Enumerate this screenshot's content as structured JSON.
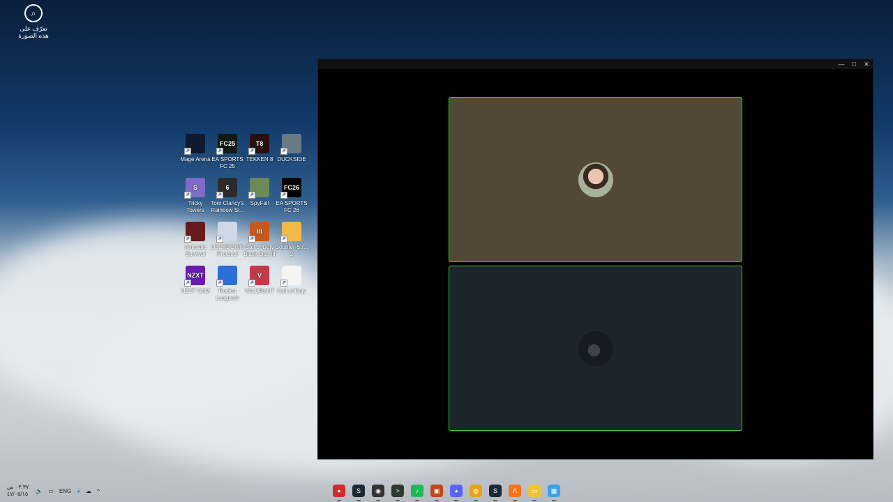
{
  "desktop": {
    "top_shortcut": {
      "line1": "تعرّف على",
      "line2": "هذه الصورة"
    },
    "icons": [
      {
        "label": "Mage Arena",
        "color": "#101a2e",
        "glyph": ""
      },
      {
        "label": "EA SPORTS FC 25",
        "color": "#0f1a12",
        "glyph": "FC25"
      },
      {
        "label": "TEKKEN 8",
        "color": "#2a0f10",
        "glyph": "T8"
      },
      {
        "label": "DUCKSIDE",
        "color": "#6a7a85",
        "glyph": ""
      },
      {
        "label": "Tricky Towers",
        "color": "#7e6cc8",
        "glyph": "S"
      },
      {
        "label": "Tom Clancy's Rainbow Si...",
        "color": "#2b2b2b",
        "glyph": "6"
      },
      {
        "label": "SpyFall",
        "color": "#6a8a5a",
        "glyph": ""
      },
      {
        "label": "EA SPORTS FC 26",
        "color": "#000000",
        "glyph": "FC26"
      },
      {
        "label": "Animatic Survival",
        "color": "#6a1a1a",
        "glyph": ""
      },
      {
        "label": "LOCKDOWN Protocol",
        "color": "#cfd8e6",
        "glyph": ""
      },
      {
        "label": "Call of Duty Black Ops III",
        "color": "#c4591b",
        "glyph": "III"
      },
      {
        "label": "Counter-Str... 2",
        "color": "#f1b84a",
        "glyph": ""
      },
      {
        "label": "NZXT CAM",
        "color": "#6b1bb0",
        "glyph": "NZXT"
      },
      {
        "label": "Rocket League®",
        "color": "#2c6fd6",
        "glyph": ""
      },
      {
        "label": "VALORANT",
        "color": "#c23a4b",
        "glyph": "V"
      },
      {
        "label": "Call of Duty",
        "color": "#f4f4f4",
        "glyph": ""
      }
    ]
  },
  "window": {
    "controls": [
      "—",
      "□",
      "✕"
    ]
  },
  "taskbar": {
    "apps": [
      {
        "name": "red-app",
        "color": "#d12b2b",
        "glyph": "●"
      },
      {
        "name": "steam-app",
        "color": "#1b2838",
        "glyph": "S"
      },
      {
        "name": "obs-app",
        "color": "#333333",
        "glyph": "◉"
      },
      {
        "name": "terminal-app",
        "color": "#2d3b2d",
        "glyph": ">"
      },
      {
        "name": "spotify-app",
        "color": "#1db954",
        "glyph": "♪"
      },
      {
        "name": "game-app",
        "color": "#c4441b",
        "glyph": "▣"
      },
      {
        "name": "discord-app",
        "color": "#5865f2",
        "glyph": "◕"
      },
      {
        "name": "chrome-app",
        "color": "#e8a11a",
        "glyph": "◍"
      },
      {
        "name": "steam2-app",
        "color": "#1b2838",
        "glyph": "S"
      },
      {
        "name": "arc-app",
        "color": "#f97316",
        "glyph": "Λ"
      },
      {
        "name": "explorer-app",
        "color": "#f2c335",
        "glyph": "▭"
      },
      {
        "name": "store-app",
        "color": "#39a1e8",
        "glyph": "▦"
      }
    ],
    "tray": {
      "lang": "ENG",
      "time": "٠٢:٣٧ ص",
      "date": "٤٧/٠٥/١٥"
    }
  }
}
